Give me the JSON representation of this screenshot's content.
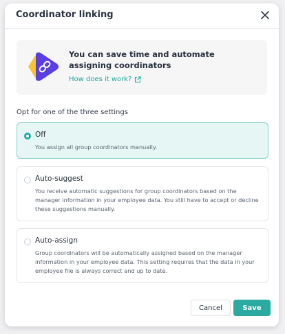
{
  "dialog": {
    "title": "Coordinator linking"
  },
  "info": {
    "title": "You can save time and automate assigning coordinators",
    "link_label": "How does it work?"
  },
  "section_label": "Opt for one of the three settings",
  "options": [
    {
      "title": "Off",
      "description": "You assign all group coordinators manually.",
      "selected": true
    },
    {
      "title": "Auto-suggest",
      "description": "You receive automatic suggestions for group coordinators based on the manager information in your employee data. You still have to accept or decline these suggestions manually.",
      "selected": false
    },
    {
      "title": "Auto-assign",
      "description": "Group coordinators will be automatically assigned based on the manager information in your employee data. This setting requires that the data in your employee file is always correct and up to date.",
      "selected": false
    }
  ],
  "footer": {
    "cancel_label": "Cancel",
    "save_label": "Save"
  },
  "colors": {
    "accent": "#2aaaa0",
    "selected_bg": "#e6f6f4",
    "link": "#1aa59b",
    "graphic_purple": "#5b3fe0",
    "graphic_yellow": "#f7c531"
  },
  "icons": {
    "close": "close-icon",
    "external_link": "external-link-icon",
    "link_graphic": "link-icon"
  }
}
